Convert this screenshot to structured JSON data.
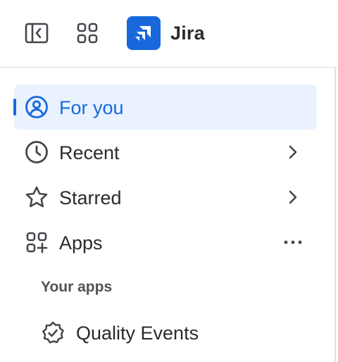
{
  "header": {
    "sidebar_toggle_icon": "sidebar-collapse-icon",
    "app_switcher_icon": "app-grid-icon",
    "brand": {
      "name": "Jira",
      "logo_icon": "jira-logo-icon",
      "logo_color": "#1868db"
    }
  },
  "nav": {
    "items": [
      {
        "label": "For you",
        "icon": "user-circle-icon",
        "active": true
      },
      {
        "label": "Recent",
        "icon": "clock-icon",
        "trailing": "chevron-right-icon"
      },
      {
        "label": "Starred",
        "icon": "star-icon",
        "trailing": "chevron-right-icon"
      },
      {
        "label": "Apps",
        "icon": "apps-add-icon",
        "trailing": "more-horizontal-icon"
      }
    ]
  },
  "your_apps": {
    "heading": "Your apps",
    "items": [
      {
        "label": "Quality Events",
        "icon": "verified-badge-icon"
      }
    ]
  },
  "colors": {
    "accent": "#1868db",
    "active_background": "#e9f2fe",
    "text": "#292a2e",
    "subtle_text": "#505258",
    "border": "#dcdfe4"
  }
}
